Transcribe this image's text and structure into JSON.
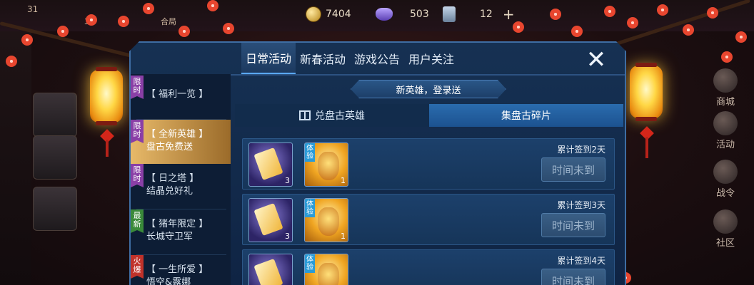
{
  "topbar": {
    "level": "31",
    "level_sub": "30",
    "guild_tag": "合局",
    "gold": "7404",
    "gems": "503",
    "tickets": "12",
    "plus": "+"
  },
  "right_nav": [
    {
      "label": "商城",
      "icon": "shop-icon"
    },
    {
      "label": "活动",
      "icon": "event-icon"
    },
    {
      "label": "战令",
      "icon": "battlepass-icon"
    },
    {
      "label": "社区",
      "icon": "community-icon"
    }
  ],
  "panel": {
    "tabs": [
      {
        "label": "日常活动",
        "active": true
      },
      {
        "label": "新春活动",
        "active": false
      },
      {
        "label": "游戏公告",
        "active": false
      },
      {
        "label": "用户关注",
        "active": false
      }
    ],
    "close_symbol": "✕"
  },
  "side_menu": [
    {
      "badge": "限时",
      "badge_color": "purple",
      "line1": "【 福利一览 】",
      "line2": "",
      "active": false
    },
    {
      "badge": "限时",
      "badge_color": "purple",
      "line1": "【 全新英雄 】",
      "line2": "盘古免费送",
      "active": true
    },
    {
      "badge": "限时",
      "badge_color": "purple",
      "line1": "【 日之塔 】",
      "line2": "结晶兑好礼",
      "active": false
    },
    {
      "badge": "最新",
      "badge_color": "green",
      "line1": "【 猪年限定 】",
      "line2": "长城守卫军",
      "active": false
    },
    {
      "badge": "火爆",
      "badge_color": "red",
      "line1": "【 一生所爱 】",
      "line2": "悟空&露娜",
      "active": false
    }
  ],
  "content": {
    "banner": "新英雄，登录送",
    "subtabs": [
      {
        "label": "兑盘古英雄",
        "active": false
      },
      {
        "label": "集盘古碎片",
        "active": true
      }
    ],
    "trial_tag": "体验",
    "rewards": [
      {
        "fragment_qty": "3",
        "skin_qty": "1",
        "sign_text": "累计签到2天",
        "button": "时间未到"
      },
      {
        "fragment_qty": "3",
        "skin_qty": "1",
        "sign_text": "累计签到3天",
        "button": "时间未到"
      },
      {
        "fragment_qty": "3",
        "skin_qty": "1",
        "sign_text": "累计签到4天",
        "button": "时间未到"
      }
    ]
  },
  "colors": {
    "panel_bg": "#163153",
    "active_side": "#e7b969",
    "accent_blue": "#2a6cae"
  }
}
